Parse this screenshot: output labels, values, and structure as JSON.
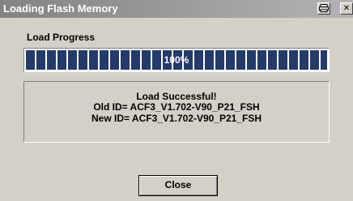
{
  "window": {
    "title": "Loading Flash Memory",
    "print_icon": "printer-icon",
    "close_icon": "close-icon"
  },
  "progress": {
    "label": "Load Progress",
    "value_text": "100%",
    "value": 1.0,
    "fill_color": "#243a69"
  },
  "message": {
    "status": "Load Successful!",
    "old_id": "Old ID= ACF3_V1.702-V90_P21_FSH",
    "new_id": "New ID= ACF3_V1.702-V90_P21_FSH"
  },
  "buttons": {
    "close_label": "Close"
  }
}
